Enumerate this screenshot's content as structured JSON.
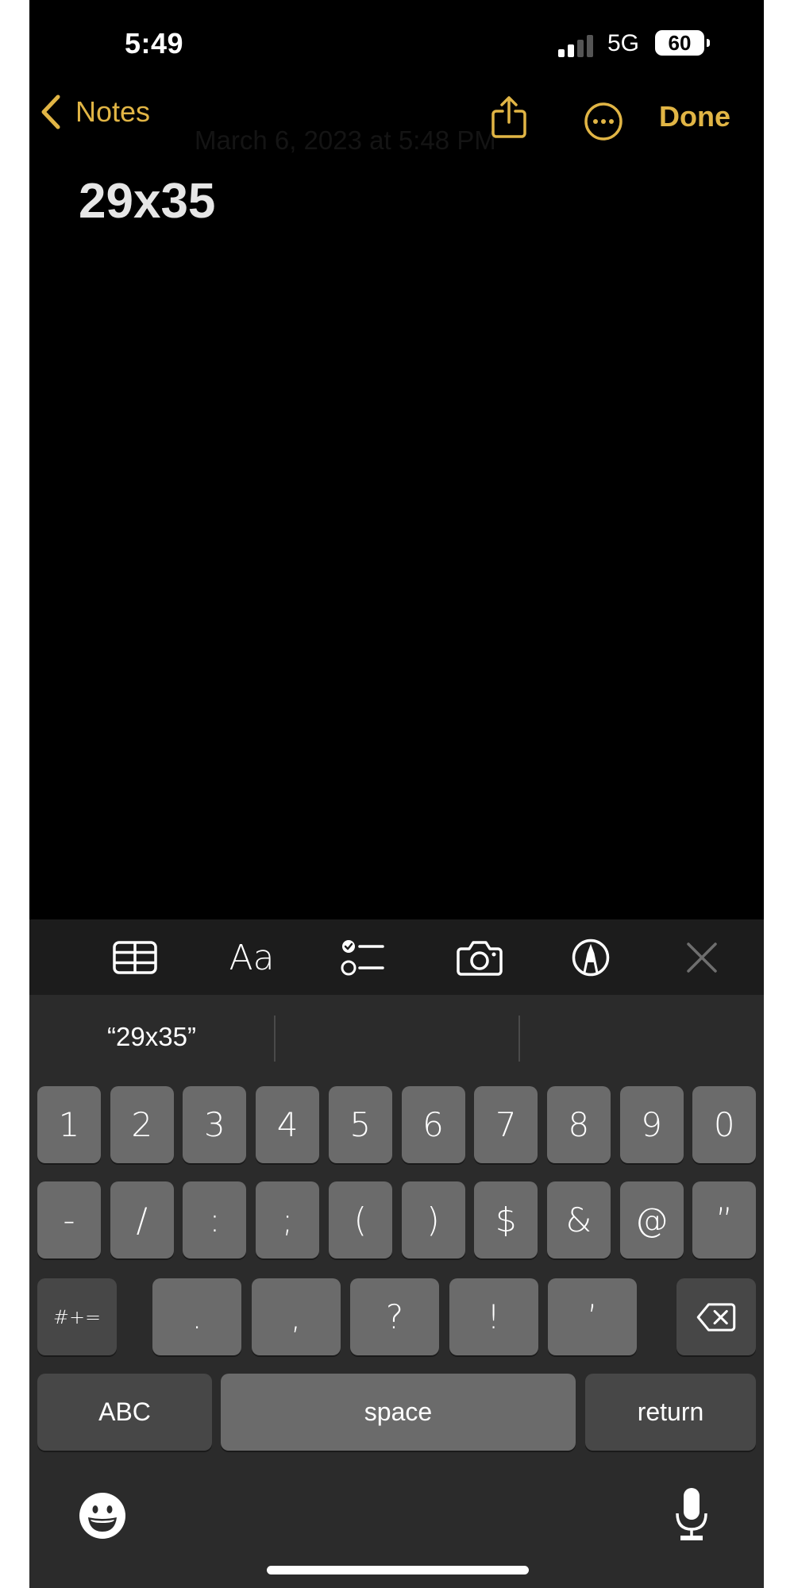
{
  "status_bar": {
    "time": "5:49",
    "signal_bars_active": 2,
    "signal_bars_total": 4,
    "network": "5G",
    "battery": "60"
  },
  "nav": {
    "back_label": "Notes",
    "date_text": "March 6, 2023 at 5:48 PM",
    "share_icon": "share-icon",
    "more_icon": "ellipsis-circle-icon",
    "done_label": "Done"
  },
  "note": {
    "title": "29x35"
  },
  "toolbar": {
    "items": [
      {
        "name": "table",
        "icon": "table-icon"
      },
      {
        "name": "format",
        "label": "Aa",
        "icon": "text-format-icon"
      },
      {
        "name": "checklist",
        "icon": "checklist-icon"
      },
      {
        "name": "camera",
        "icon": "camera-icon"
      },
      {
        "name": "markup",
        "icon": "markup-pen-icon"
      },
      {
        "name": "close",
        "icon": "close-icon"
      }
    ]
  },
  "keyboard": {
    "suggestions": [
      "“29x35”",
      "",
      ""
    ],
    "row1": [
      "1",
      "2",
      "3",
      "4",
      "5",
      "6",
      "7",
      "8",
      "9",
      "0"
    ],
    "row2": [
      "-",
      "/",
      ":",
      ";",
      "(",
      ")",
      "$",
      "&",
      "@",
      "”"
    ],
    "row3": {
      "symbols_label": "#+=",
      "keys": [
        ".",
        ",",
        "?",
        "!",
        "’"
      ],
      "delete_icon": "backspace-icon"
    },
    "row4": {
      "abc_label": "ABC",
      "space_label": "space",
      "return_label": "return"
    },
    "emoji_icon": "emoji-icon",
    "dictation_icon": "microphone-icon"
  },
  "colors": {
    "accent": "#E1B545",
    "background": "#000000",
    "toolbar": "#1C1C1C",
    "keyboard": "#2B2B2B",
    "key": "#6B6B6B",
    "key_dark": "#474747"
  }
}
